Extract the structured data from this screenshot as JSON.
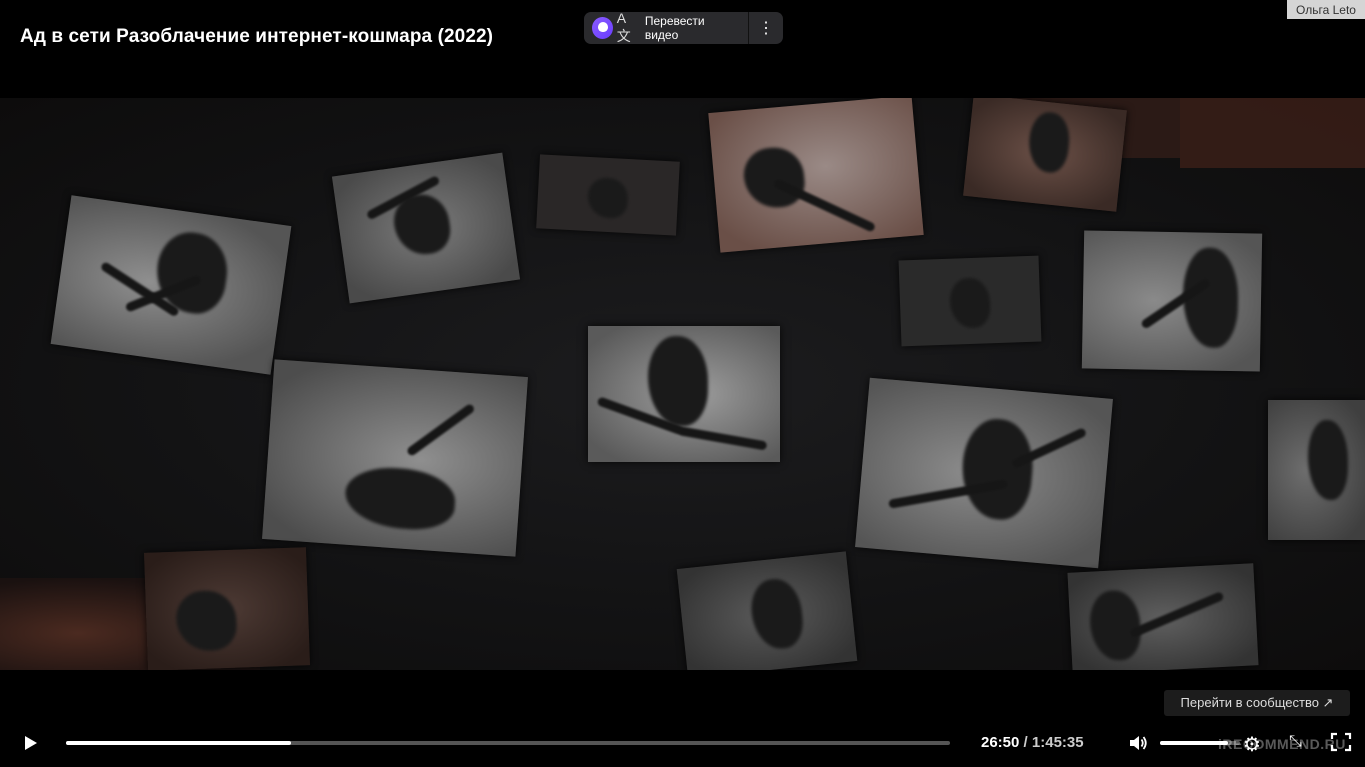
{
  "video": {
    "title": "Ад в сети Разоблачение интернет-кошмара (2022)"
  },
  "translate": {
    "label": "Перевести видео",
    "glyph": "A文",
    "more": "⋮"
  },
  "user": {
    "name": "Ольга Leto"
  },
  "community_button": {
    "label": "Перейти в сообщество ↗"
  },
  "player": {
    "current_time": "26:50",
    "separator": " / ",
    "total_time": "1:45:35",
    "progress_fraction": 0.255,
    "volume_fraction": 0.85
  },
  "icons": {
    "play": "play-icon",
    "volume": "volume-icon",
    "settings": "gear-icon",
    "pip": "pip-icon",
    "fullscreen": "fullscreen-icon",
    "settings_glyph": "⚙",
    "pip_glyph": "⤡"
  },
  "watermark": {
    "text": "iRECOMMEND.RU"
  },
  "colors": {
    "background": "#000000",
    "accent": "#ffffff",
    "alice": "#7a4cff"
  }
}
